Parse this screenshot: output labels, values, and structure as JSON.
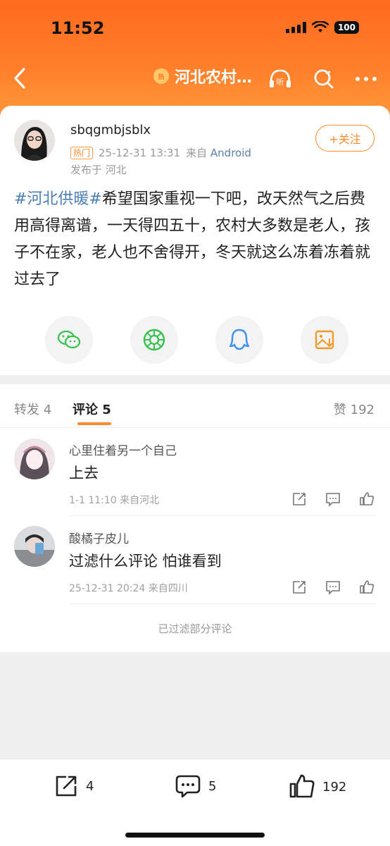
{
  "status_bar": {
    "time": "11:52",
    "battery": "100"
  },
  "nav": {
    "topic_badge": "热",
    "topic_title": "河北农村…"
  },
  "post": {
    "username": "sbqgmbjsblx",
    "hot_badge": "热门",
    "date": "25-12-31 13:31",
    "from_prefix": "来自",
    "source": "Android",
    "location": "发布于 河北",
    "follow_label": "+关注",
    "tag": "#河北供暖#",
    "body": "希望国家重视一下吧，改天然气之后费用高得离谱，一天得四五十，农村大多数是老人，孩子不在家，老人也不舍得开，冬天就这么冻着冻着就过去了"
  },
  "tabs": {
    "repost": "转发 4",
    "comments": "评论 5",
    "likes": "赞 192"
  },
  "comments": [
    {
      "user": "心里住着另一个自己",
      "text": "上去",
      "meta": "1-1 11:10 来自河北"
    },
    {
      "user": "酸橘子皮儿",
      "text": "过滤什么评论 怕谁看到",
      "meta": "25-12-31 20:24 来自四川"
    }
  ],
  "filtered_note": "已过滤部分评论",
  "bottom_bar": {
    "repost_count": "4",
    "comment_count": "5",
    "like_count": "192"
  },
  "colors": {
    "accent": "#ff8a2d",
    "link": "#4a7fb6"
  }
}
